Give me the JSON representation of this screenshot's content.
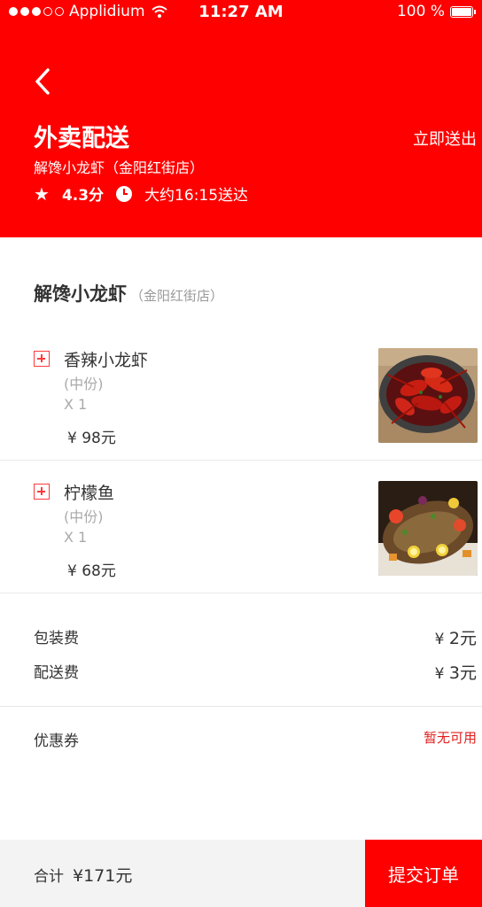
{
  "status_bar": {
    "carrier": "Applidium",
    "time": "11:27 AM",
    "battery": "100 %"
  },
  "header": {
    "title": "外卖配送",
    "delivery_option": "立即送出",
    "shop_full": "解馋小龙虾（金阳红街店）",
    "rating": "4.3分",
    "eta": "大约16:15送达"
  },
  "shop": {
    "name": "解馋小龙虾",
    "branch": "（金阳红街店）"
  },
  "items": [
    {
      "name": "香辣小龙虾",
      "spec": "(中份)",
      "qty": "X 1",
      "price": "¥  98元"
    },
    {
      "name": "柠檬鱼",
      "spec": "(中份)",
      "qty": "X 1",
      "price": "¥  68元"
    }
  ],
  "fees": {
    "packaging_label": "包装费",
    "packaging_symbol": "¥",
    "packaging_value": "2元",
    "delivery_label": "配送费",
    "delivery_symbol": "¥",
    "delivery_value": "3元"
  },
  "coupon": {
    "label": "优惠券",
    "status": "暂无可用"
  },
  "footer": {
    "total_label": "合计",
    "total_value": "¥171元",
    "submit_label": "提交订单"
  },
  "colors": {
    "brand": "#fe0000",
    "coupon": "#e02020"
  }
}
